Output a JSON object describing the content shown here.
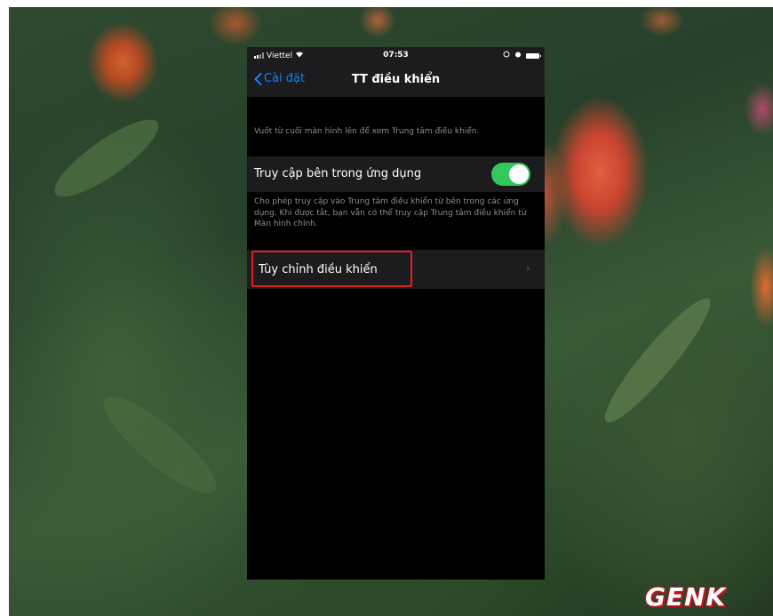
{
  "status_bar": {
    "carrier": "Viettel",
    "time": "07:53",
    "icons": [
      "signal-icon",
      "wifi-icon",
      "alarm-icon",
      "battery-icon"
    ]
  },
  "nav": {
    "back_label": "Cài đặt",
    "title": "TT điều khiển"
  },
  "content": {
    "hint": "Vuốt từ cuối màn hình lên để xem Trung tâm điều khiển.",
    "access_in_apps": {
      "label": "Truy cập bên trong ứng dụng",
      "enabled": true
    },
    "description": "Cho phép truy cập vào Trung tâm điều khiển từ bên trong các ứng dụng. Khi được tắt, bạn vẫn có thể truy cập Trung tâm điều khiển từ Màn hình chính.",
    "customize_label": "Tùy chỉnh điều khiển"
  },
  "watermark": "GENK",
  "colors": {
    "accent": "#0a84ff",
    "toggle_on": "#34c759",
    "highlight": "#e02020"
  }
}
